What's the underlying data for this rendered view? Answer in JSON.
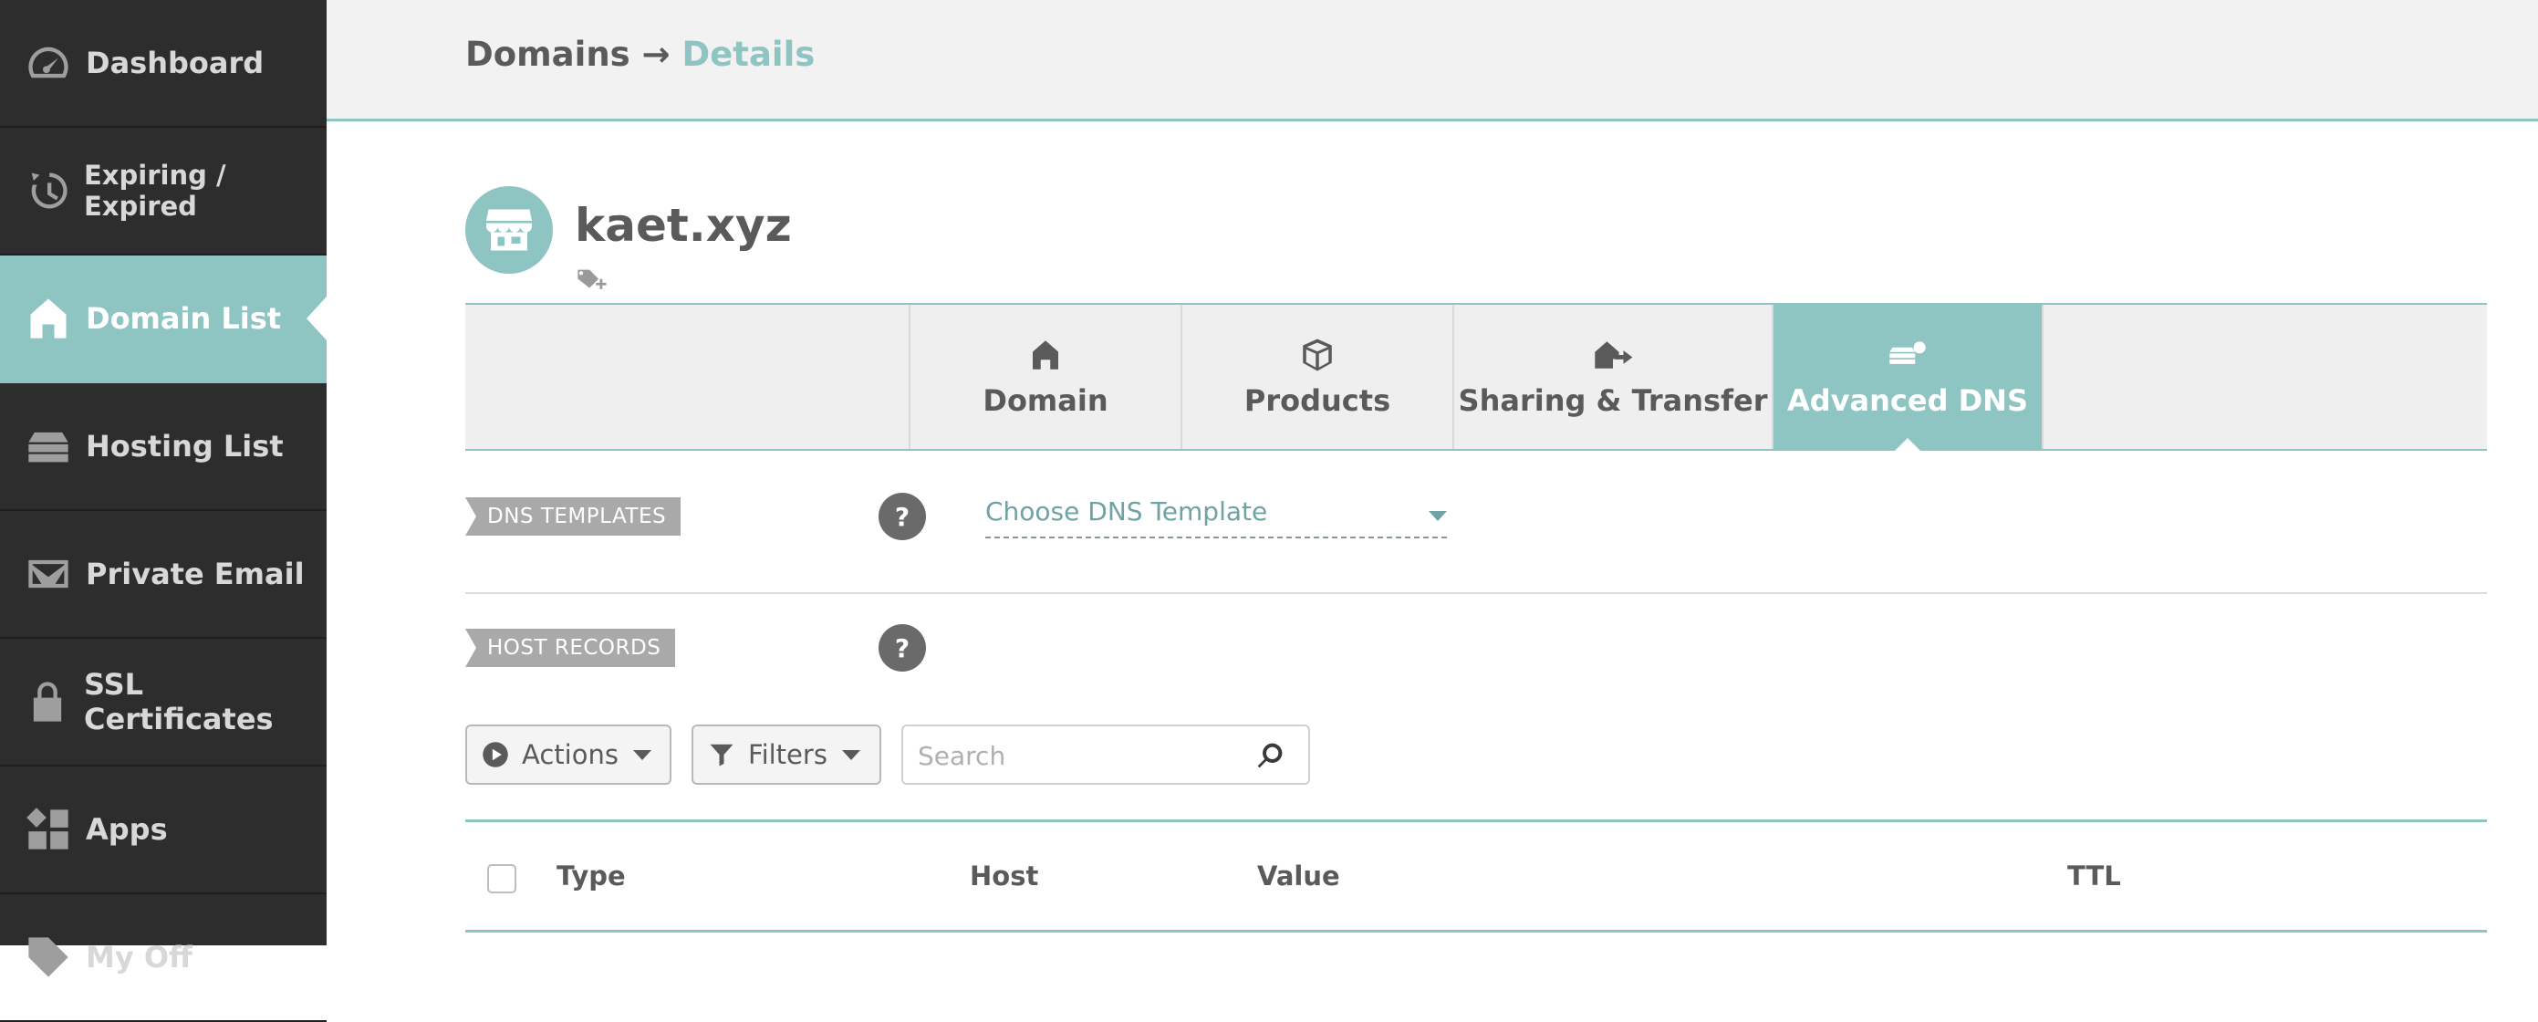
{
  "sidebar": {
    "items": [
      {
        "label": "Dashboard",
        "icon": "speedometer-icon"
      },
      {
        "label": "Expiring / Expired",
        "icon": "clock-icon"
      },
      {
        "label": "Domain List",
        "icon": "home-icon",
        "active": true
      },
      {
        "label": "Hosting List",
        "icon": "server-icon"
      },
      {
        "label": "Private Email",
        "icon": "envelope-icon"
      },
      {
        "label": "SSL Certificates",
        "icon": "lock-icon"
      },
      {
        "label": "Apps",
        "icon": "apps-icon"
      },
      {
        "label": "My Off",
        "icon": "tag-icon"
      }
    ]
  },
  "header": {
    "breadcrumb_root": "Domains",
    "breadcrumb_sep": " → ",
    "breadcrumb_current": "Details"
  },
  "domain": {
    "name": "kaet.xyz"
  },
  "tabs": [
    {
      "label": "Domain",
      "icon": "home-icon"
    },
    {
      "label": "Products",
      "icon": "box-icon"
    },
    {
      "label": "Sharing & Transfer",
      "icon": "share-home-icon"
    },
    {
      "label": "Advanced DNS",
      "icon": "dns-server-icon",
      "active": true
    }
  ],
  "dns_templates": {
    "tag": "DNS TEMPLATES",
    "help": "?",
    "select_value": "Choose DNS Template"
  },
  "host_records": {
    "tag": "HOST RECORDS",
    "help": "?",
    "actions_label": "Actions",
    "filters_label": "Filters",
    "search_placeholder": "Search",
    "columns": [
      "Type",
      "Host",
      "Value",
      "TTL"
    ]
  },
  "colors": {
    "accent": "#8ec5c3",
    "sidebar_bg": "#2d2d2d"
  }
}
